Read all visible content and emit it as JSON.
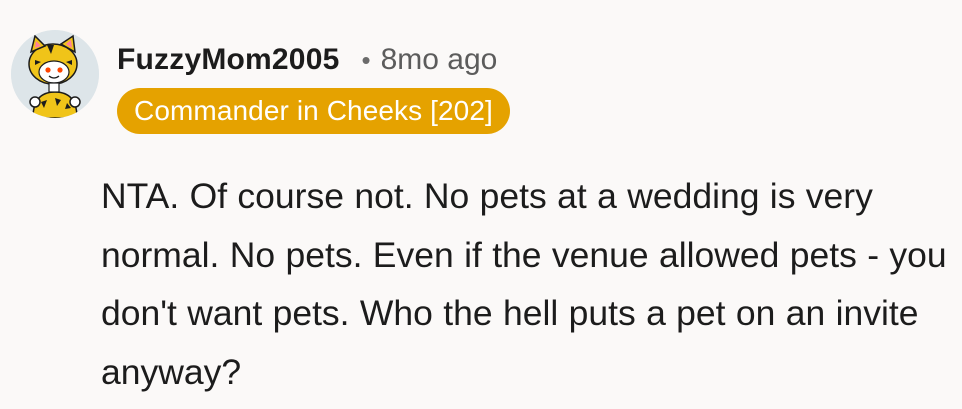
{
  "comment": {
    "author": "FuzzyMom2005",
    "separator": "•",
    "timestamp": "8mo ago",
    "flair": "Commander in Cheeks [202]",
    "body": "NTA. Of course not. No pets at a wedding is very normal. No pets. Even if the venue allowed pets - you don't want pets. Who the hell puts a pet on an invite anyway?",
    "avatar_icon": "snoo-tiger-costume-avatar"
  },
  "colors": {
    "background": "#fbf9f8",
    "flair_background": "#e5a200",
    "flair_text": "#ffffff",
    "text": "#1c1c1c",
    "muted_text": "#5c5c5c"
  }
}
